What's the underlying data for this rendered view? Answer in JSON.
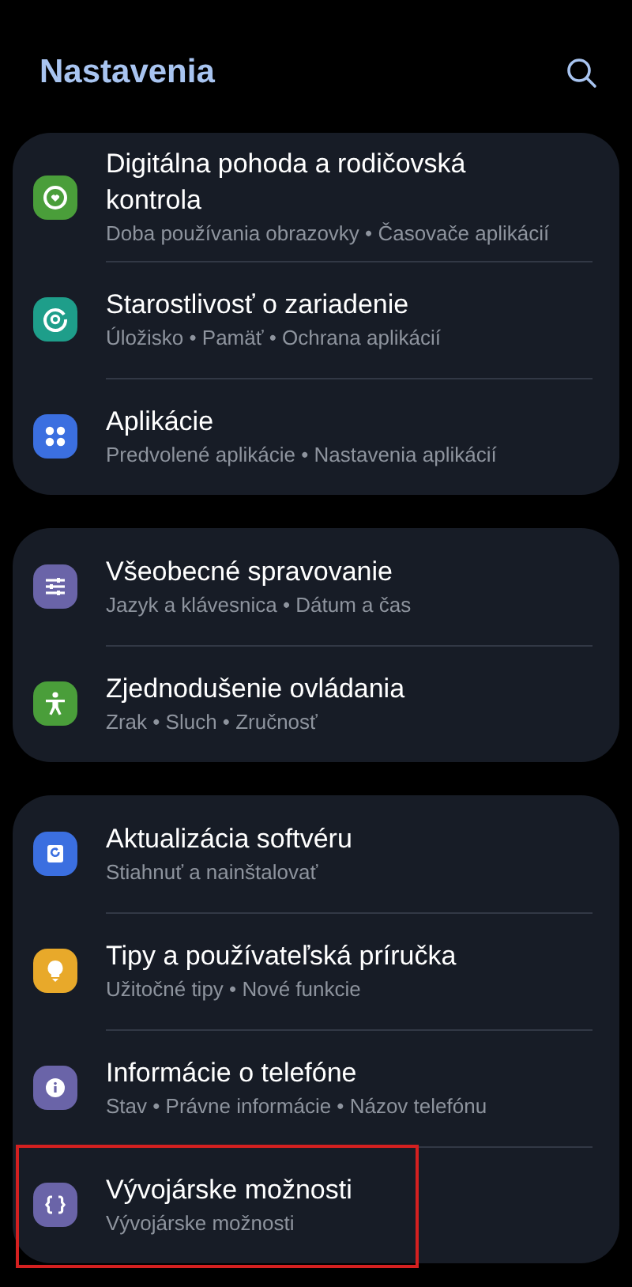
{
  "header": {
    "title": "Nastavenia"
  },
  "groups": [
    {
      "items": [
        {
          "title": "Digitálna pohoda a rodičovská kontrola",
          "subtitle": "Doba používania obrazovky • Časovače aplikácií",
          "color": "#4a9e3a",
          "highlighted": false
        },
        {
          "title": "Starostlivosť o zariadenie",
          "subtitle": "Úložisko • Pamäť • Ochrana aplikácií",
          "color": "#1e9e8a",
          "highlighted": false
        },
        {
          "title": "Aplikácie",
          "subtitle": "Predvolené aplikácie • Nastavenia aplikácií",
          "color": "#3b6fe0",
          "highlighted": false
        }
      ]
    },
    {
      "items": [
        {
          "title": "Všeobecné spravovanie",
          "subtitle": "Jazyk a klávesnica • Dátum a čas",
          "color": "#6a64a8",
          "highlighted": false
        },
        {
          "title": "Zjednodušenie ovládania",
          "subtitle": "Zrak • Sluch • Zručnosť",
          "color": "#4a9e3a",
          "highlighted": false
        }
      ]
    },
    {
      "items": [
        {
          "title": "Aktualizácia softvéru",
          "subtitle": "Stiahnuť a nainštalovať",
          "color": "#3b6fe0",
          "highlighted": false
        },
        {
          "title": "Tipy a používateľská príručka",
          "subtitle": "Užitočné tipy • Nové funkcie",
          "color": "#e8a92a",
          "highlighted": false
        },
        {
          "title": "Informácie o telefóne",
          "subtitle": "Stav • Právne informácie • Názov telefónu",
          "color": "#6a64a8",
          "highlighted": false
        },
        {
          "title": "Vývojárske možnosti",
          "subtitle": "Vývojárske možnosti",
          "color": "#6a64a8",
          "highlighted": true
        }
      ]
    }
  ]
}
